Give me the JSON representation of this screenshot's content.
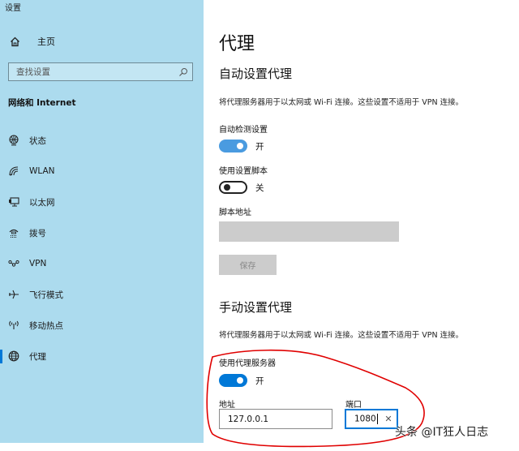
{
  "app": {
    "title": "设置"
  },
  "sidebar": {
    "home_label": "主页",
    "search_placeholder": "查找设置",
    "section_title": "网络和 Internet",
    "items": [
      {
        "label": "状态",
        "icon": "status-globe-icon"
      },
      {
        "label": "WLAN",
        "icon": "wifi-icon"
      },
      {
        "label": "以太网",
        "icon": "ethernet-icon"
      },
      {
        "label": "拨号",
        "icon": "dialup-icon"
      },
      {
        "label": "VPN",
        "icon": "vpn-icon"
      },
      {
        "label": "飞行模式",
        "icon": "airplane-icon"
      },
      {
        "label": "移动热点",
        "icon": "hotspot-icon"
      },
      {
        "label": "代理",
        "icon": "globe-icon",
        "active": true
      }
    ],
    "accent": "#0078d7"
  },
  "main": {
    "title": "代理",
    "auto": {
      "heading": "自动设置代理",
      "description": "将代理服务器用于以太网或 Wi-Fi 连接。这些设置不适用于 VPN 连接。",
      "auto_detect": {
        "label": "自动检测设置",
        "state": "开",
        "on": true
      },
      "use_script": {
        "label": "使用设置脚本",
        "state": "关",
        "on": false
      },
      "script_address": {
        "label": "脚本地址",
        "value": ""
      },
      "save_label": "保存"
    },
    "manual": {
      "heading": "手动设置代理",
      "description": "将代理服务器用于以太网或 Wi-Fi 连接。这些设置不适用于 VPN 连接。",
      "use_proxy": {
        "label": "使用代理服务器",
        "state": "开",
        "on": true
      },
      "address": {
        "label": "地址",
        "value": "127.0.0.1"
      },
      "port": {
        "label": "端口",
        "value": "1080"
      }
    }
  },
  "overlay": {
    "watermark": "头条 @IT狂人日志",
    "annotation_color": "#e00000"
  }
}
